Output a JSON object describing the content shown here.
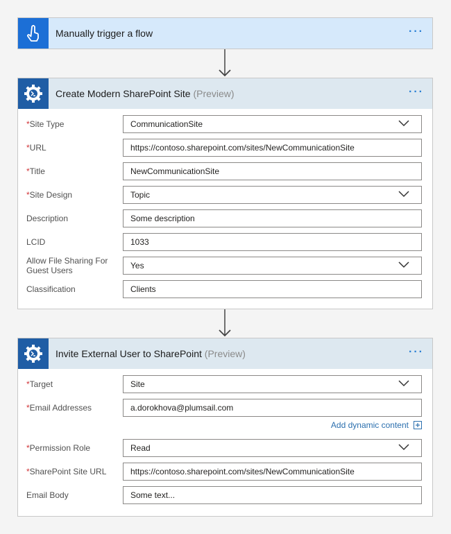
{
  "colors": {
    "trigger_icon_bg": "#1c6fd6",
    "action_icon_bg": "#1f5da5",
    "link": "#2b6fae",
    "required": "#d13438"
  },
  "trigger": {
    "icon": "hand-pointer-icon",
    "title": "Manually trigger a flow",
    "more": "···"
  },
  "action1": {
    "icon": "gear-terminal-icon",
    "title": "Create Modern SharePoint Site",
    "preview": "(Preview)",
    "more": "···",
    "fields": [
      {
        "label": "Site Type",
        "required": "*",
        "value": "CommunicationSite",
        "dropdown": true
      },
      {
        "label": "URL",
        "required": "*",
        "value": "https://contoso.sharepoint.com/sites/NewCommunicationSite"
      },
      {
        "label": "Title",
        "required": "*",
        "value": "NewCommunicationSite"
      },
      {
        "label": "Site Design",
        "required": "*",
        "value": "Topic",
        "dropdown": true
      },
      {
        "label": "Description",
        "value": "Some description"
      },
      {
        "label": "LCID",
        "value": "1033"
      },
      {
        "label": "Allow File Sharing For Guest Users",
        "value": "Yes",
        "dropdown": true
      },
      {
        "label": "Classification",
        "value": "Clients"
      }
    ]
  },
  "action2": {
    "icon": "gear-terminal-icon",
    "title": "Invite External User to SharePoint",
    "preview": "(Preview)",
    "more": "···",
    "fields": [
      {
        "label": "Target",
        "required": "*",
        "value": "Site",
        "dropdown": true
      },
      {
        "label": "Email Addresses",
        "required": "*",
        "value": "a.dorokhova@plumsail.com"
      },
      {
        "label": "Permission Role",
        "required": "*",
        "value": "Read",
        "dropdown": true
      },
      {
        "label": "SharePoint Site URL",
        "required": "*",
        "value": "https://contoso.sharepoint.com/sites/NewCommunicationSite"
      },
      {
        "label": "Email Body",
        "value": "Some text..."
      }
    ],
    "add_dynamic_content": "Add dynamic content"
  }
}
